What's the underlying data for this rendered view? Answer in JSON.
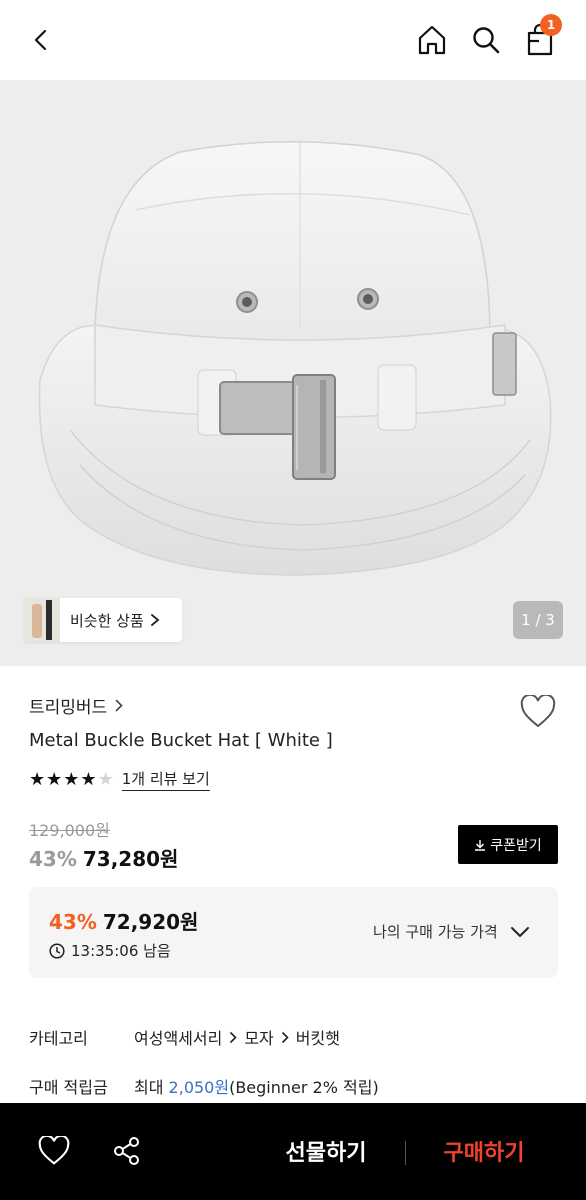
{
  "header": {
    "cart_count": "1",
    "icons": [
      "back-arrow-icon",
      "home-icon",
      "search-icon",
      "shopping-bag-icon"
    ]
  },
  "gallery": {
    "similar_label": "비슷한 상품",
    "page_indicator": "1 / 3"
  },
  "product": {
    "brand": "트리밍버드",
    "title": "Metal Buckle Bucket Hat [ White ]",
    "rating": 4,
    "rating_max": 5,
    "review_link": "1개 리뷰 보기",
    "original_price": "129,000원",
    "discount_rate": "43%",
    "sale_price": "73,280원",
    "coupon_button": "쿠폰받기"
  },
  "my_price": {
    "discount_rate": "43%",
    "price": "72,920원",
    "timer": "13:35:06 남음",
    "label": "나의 구매 가능 가격"
  },
  "specs": {
    "category_key": "카테고리",
    "category_path": [
      "여성액세서리",
      "모자",
      "버킷햇"
    ],
    "points_key": "구매 적립금",
    "points_prefix": "최대",
    "points_value": "2,050원",
    "points_suffix": "(Beginner 2% 적립)"
  },
  "bottom_bar": {
    "gift_label": "선물하기",
    "buy_label": "구매하기"
  },
  "colors": {
    "accent_orange": "#f26122",
    "buy_red": "#f0432a",
    "points_blue": "#3b6fc6"
  }
}
